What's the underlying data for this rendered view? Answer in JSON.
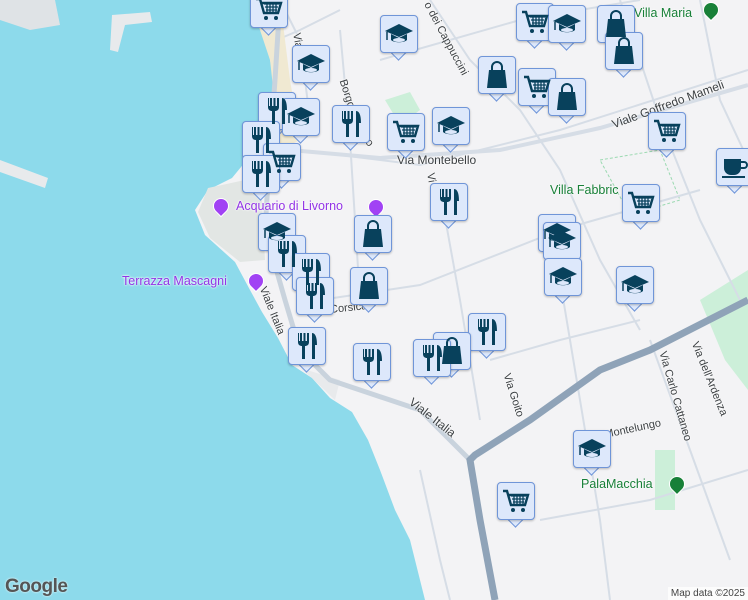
{
  "streets": {
    "viale_italia_1": "Viale Italia",
    "viale_italia_2": "Viale Italia",
    "via_montebello": "Via Montebello",
    "viale_goffredo_mameli": "Viale Goffredo Mameli",
    "cappuccini": "o dei Cappuccini",
    "borgo": "Borgo",
    "borgo_2": "po",
    "corsica": "Corsica",
    "via_goito": "Via Goito",
    "via_carlo_cattaneo": "Via Carlo Cattaneo",
    "via_ardenza": "Via dell'Ardenza",
    "montelungo": "Montelungo",
    "via_v": "Vi",
    "viale_top": "Vial"
  },
  "pois": {
    "acquario": "Acquario di Livorno",
    "terrazza": "Terrazza Mascagni",
    "villa_maria": "Villa Maria",
    "villa_fabbricotti": "Villa Fabbric",
    "palamacchia": "PalaMacchia"
  },
  "branding": {
    "logo": "Google",
    "attribution": "Map data ©2025"
  },
  "colors": {
    "water": "#8ddaeb",
    "land": "#f3f3f5",
    "highway": "#8fa3b8",
    "marker_icon": "#08415c",
    "marker_bg": "#dde8fb"
  },
  "marker_types": {
    "cart": "shopping-cart-icon",
    "school": "graduation-cap-icon",
    "bag": "shopping-bag-icon",
    "fork": "restaurant-icon",
    "cup": "cafe-icon"
  }
}
